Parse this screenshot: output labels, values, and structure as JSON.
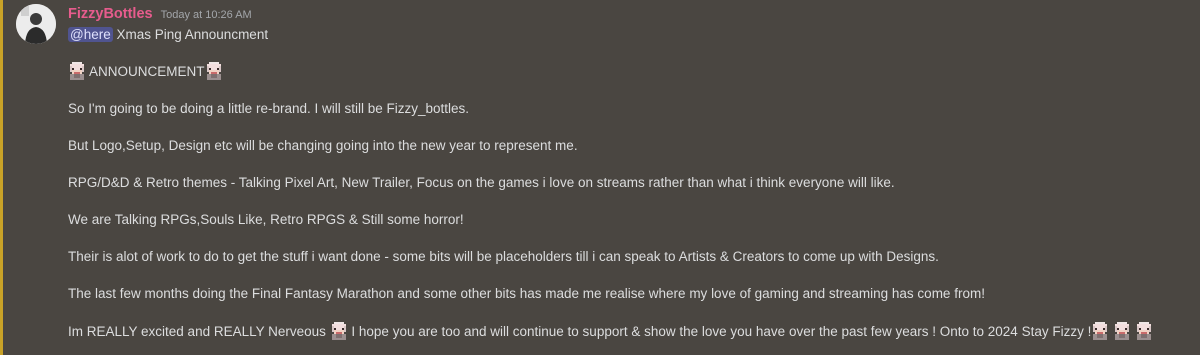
{
  "message": {
    "author": "FizzyBottles",
    "timestamp": "Today at 10:26 AM",
    "mention": "@here",
    "mention_suffix": " Xmas Ping Announcment",
    "announcement_title": "ANNOUNCEMENT",
    "paragraphs": [
      "So I'm going to be doing a little re-brand. I will still be Fizzy_bottles.",
      "But Logo,Setup, Design etc will be changing going into the new year to represent me.",
      "RPG/D&D & Retro themes - Talking Pixel Art, New Trailer, Focus on the games i love on streams rather than what i think everyone will like.",
      "We are Talking RPGs,Souls Like, Retro RPGS & Still some horror!",
      "Their is alot of work to do to get the stuff i want done - some bits will be placeholders till i can speak to Artists & Creators to come up with Designs.",
      "The last few months doing the Final Fantasy Marathon and some other bits has made me realise where my love of gaming and streaming has come from!"
    ],
    "last_line_start": "Im REALLY excited and REALLY Nerveous ",
    "last_line_end": " I hope you are too and will continue to support & show the love you have over the past few years ! Onto to 2024 Stay Fizzy  !"
  },
  "colors": {
    "background": "#4a4641",
    "username": "#e75c8d",
    "highlight_bar": "#c9a227",
    "mention_bg": "#5865f2"
  },
  "icons": {
    "avatar": "avatar-photo",
    "emoji": "pixel-character-emoji"
  }
}
